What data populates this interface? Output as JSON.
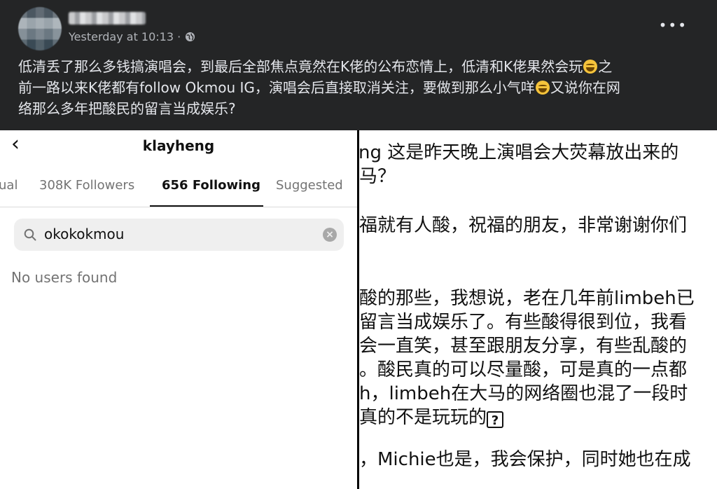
{
  "post": {
    "timestamp": "Yesterday at 10:13 ·",
    "more_label": "•••",
    "text_lines": [
      "低清丢了那么多钱搞演唱会，到最后全部焦点竟然在K佬的公布恋情上，低清和K佬果然会玩",
      "之",
      "前一路以来K佬都有follow Okmou IG，演唱会后直接取消关注，要做到那么小气咩",
      "又说你在网",
      "络那么多年把酸民的留言当成娱乐?"
    ],
    "privacy_icon": "globe-icon",
    "emoji": "rolling-laughing-emoji"
  },
  "instagram": {
    "username": "klayheng",
    "tabs": [
      "ual",
      "308K Followers",
      "656 Following",
      "Suggested"
    ],
    "active_tab": "656 Following",
    "search_value": "okokokmou",
    "empty_message": "No users found"
  },
  "text_crop": {
    "lines": [
      "ng 这是昨天晚上演唱会大荧幕放出来的",
      "马？",
      "福就有人酸，祝福的朋友，非常谢谢你们",
      "酸的那些，我想说，老在几年前limbeh已",
      "留言当成娱乐了。有些酸得很到位，我看",
      "会一直笑，甚至跟朋友分享，有些乱酸的",
      "。酸民真的可以尽量酸，可是真的一点都",
      "h，limbeh在大马的网络圈也混了一段时",
      "真的不是玩玩的",
      "，Michie也是，我会保护，同时她也在成"
    ],
    "unknown_glyph": "?"
  }
}
